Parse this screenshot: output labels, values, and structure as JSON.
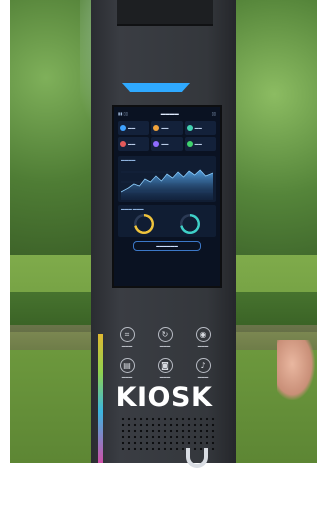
{
  "caption": "KIOSK",
  "screen": {
    "stat_tiles": [
      {
        "color": "#3fa2ff"
      },
      {
        "color": "#f0a33c"
      },
      {
        "color": "#42d0b0"
      },
      {
        "color": "#e35a5a"
      },
      {
        "color": "#8f6bff"
      },
      {
        "color": "#3fd36d"
      }
    ],
    "ring_colors": [
      "#f0c43c",
      "#3fd0c8"
    ],
    "accent": "#2fa9ff"
  },
  "buttons": [
    {
      "icon": "chip-icon"
    },
    {
      "icon": "refresh-icon"
    },
    {
      "icon": "drop-icon"
    },
    {
      "icon": "document-icon"
    },
    {
      "icon": "camera-icon"
    },
    {
      "icon": "bell-icon"
    }
  ]
}
